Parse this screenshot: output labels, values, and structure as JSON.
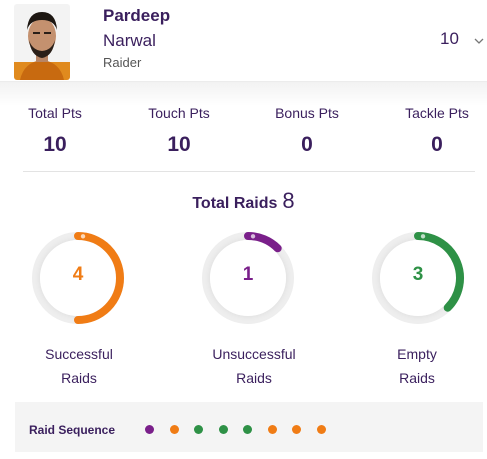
{
  "player": {
    "first_name": "Pardeep",
    "last_name": "Narwal",
    "role": "Raider",
    "points": "10",
    "avatar_icon": "player-photo",
    "dropdown_icon": "chevron-down-icon"
  },
  "stats": [
    {
      "label": "Total Pts",
      "value": "10"
    },
    {
      "label": "Touch Pts",
      "value": "10"
    },
    {
      "label": "Bonus Pts",
      "value": "0"
    },
    {
      "label": "Tackle Pts",
      "value": "0"
    }
  ],
  "total_raids": {
    "label": "Total Raids",
    "value": "8"
  },
  "raids": [
    {
      "value": "4",
      "label_line1": "Successful",
      "label_line2": "Raids",
      "color": "#f07c15",
      "fraction": 0.5
    },
    {
      "value": "1",
      "label_line1": "Unsuccessful",
      "label_line2": "Raids",
      "color": "#7a1f8a",
      "fraction": 0.125
    },
    {
      "value": "3",
      "label_line1": "Empty",
      "label_line2": "Raids",
      "color": "#2e9146",
      "fraction": 0.375
    }
  ],
  "raid_sequence": {
    "label": "Raid Sequence",
    "dots": [
      "#7a1f8a",
      "#f07c15",
      "#2e9146",
      "#2e9146",
      "#2e9146",
      "#f07c15",
      "#f07c15",
      "#f07c15"
    ]
  }
}
